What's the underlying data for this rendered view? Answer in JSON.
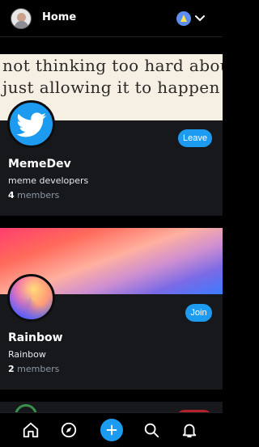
{
  "header": {
    "title": "Home",
    "avatar_icon": "user-avatar",
    "feed_icon": "feed-switch-icon"
  },
  "communities": [
    {
      "banner_lines": [
        "not thinking too hard about",
        "just allowing it to happen as"
      ],
      "name": "MemeDev",
      "description": "meme developers",
      "member_count": "4",
      "member_label": "members",
      "action_label": "Leave",
      "avatar_icon": "twitter-bird-icon"
    },
    {
      "name": "Rainbow",
      "description": "Rainbow",
      "member_count": "2",
      "member_label": "members",
      "action_label": "Join",
      "avatar_icon": "rainbow-gradient-avatar"
    }
  ],
  "nav": {
    "items": [
      "home-icon",
      "compass-icon",
      "plus-icon",
      "search-icon",
      "bell-icon"
    ]
  },
  "colors": {
    "accent": "#1d9bf0",
    "background": "#000000",
    "card": "#16181c",
    "muted": "#8b98a5"
  }
}
